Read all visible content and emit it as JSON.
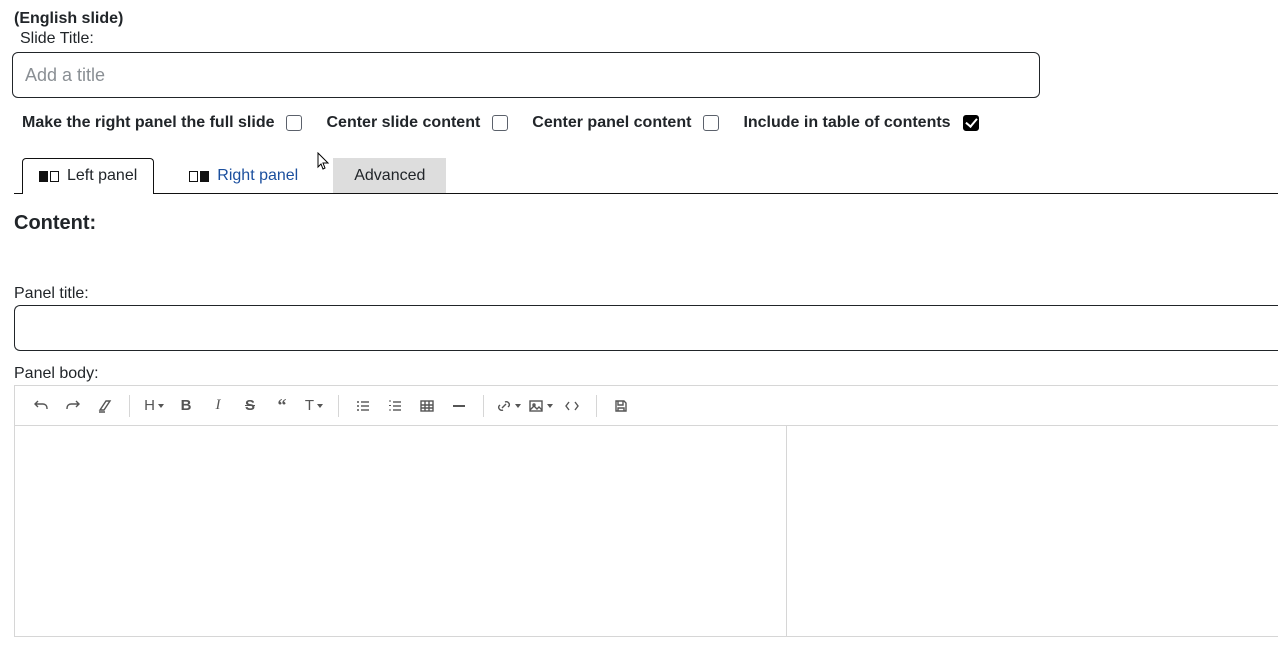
{
  "header": {
    "language_label": "(English slide)",
    "slide_title_label": "Slide Title:",
    "slide_title_placeholder": "Add a title",
    "slide_title_value": ""
  },
  "options": {
    "full_slide": {
      "label": "Make the right panel the full slide",
      "checked": false
    },
    "center_slide": {
      "label": "Center slide content",
      "checked": false
    },
    "center_panel": {
      "label": "Center panel content",
      "checked": false
    },
    "include_toc": {
      "label": "Include in table of contents",
      "checked": true
    }
  },
  "tabs": {
    "left": "Left panel",
    "right": "Right panel",
    "advanced": "Advanced",
    "active": "left"
  },
  "content": {
    "heading": "Content:",
    "panel_title_label": "Panel title:",
    "panel_title_value": "",
    "panel_body_label": "Panel body:"
  },
  "toolbar_icons": [
    "undo",
    "redo",
    "clear-format",
    "sep",
    "heading",
    "bold",
    "italic",
    "strike",
    "quote",
    "text-style",
    "sep",
    "unordered-list",
    "ordered-list",
    "table",
    "hr",
    "sep",
    "link",
    "image",
    "code",
    "sep",
    "save"
  ]
}
